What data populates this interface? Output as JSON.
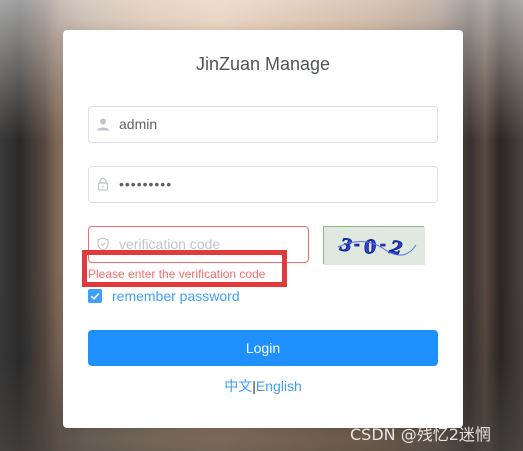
{
  "title": "JinZuan Manage",
  "username": {
    "value": "admin",
    "icon": "user-icon"
  },
  "password": {
    "value": "•••••••••",
    "icon": "lock-icon"
  },
  "verification": {
    "placeholder": "verification code",
    "icon": "shield-icon",
    "captcha_text": "3-0-2"
  },
  "error_message": "Please enter the verification code",
  "remember": {
    "label": "remember password",
    "checked": true
  },
  "login_button": "Login",
  "languages": {
    "chinese": "中文",
    "separator": "|",
    "english": "English"
  },
  "watermark": "CSDN @残忆2迷惘",
  "colors": {
    "primary": "#1e90ff",
    "link": "#409eff",
    "error": "#f56c6c",
    "highlight_box": "#e23a3a"
  }
}
